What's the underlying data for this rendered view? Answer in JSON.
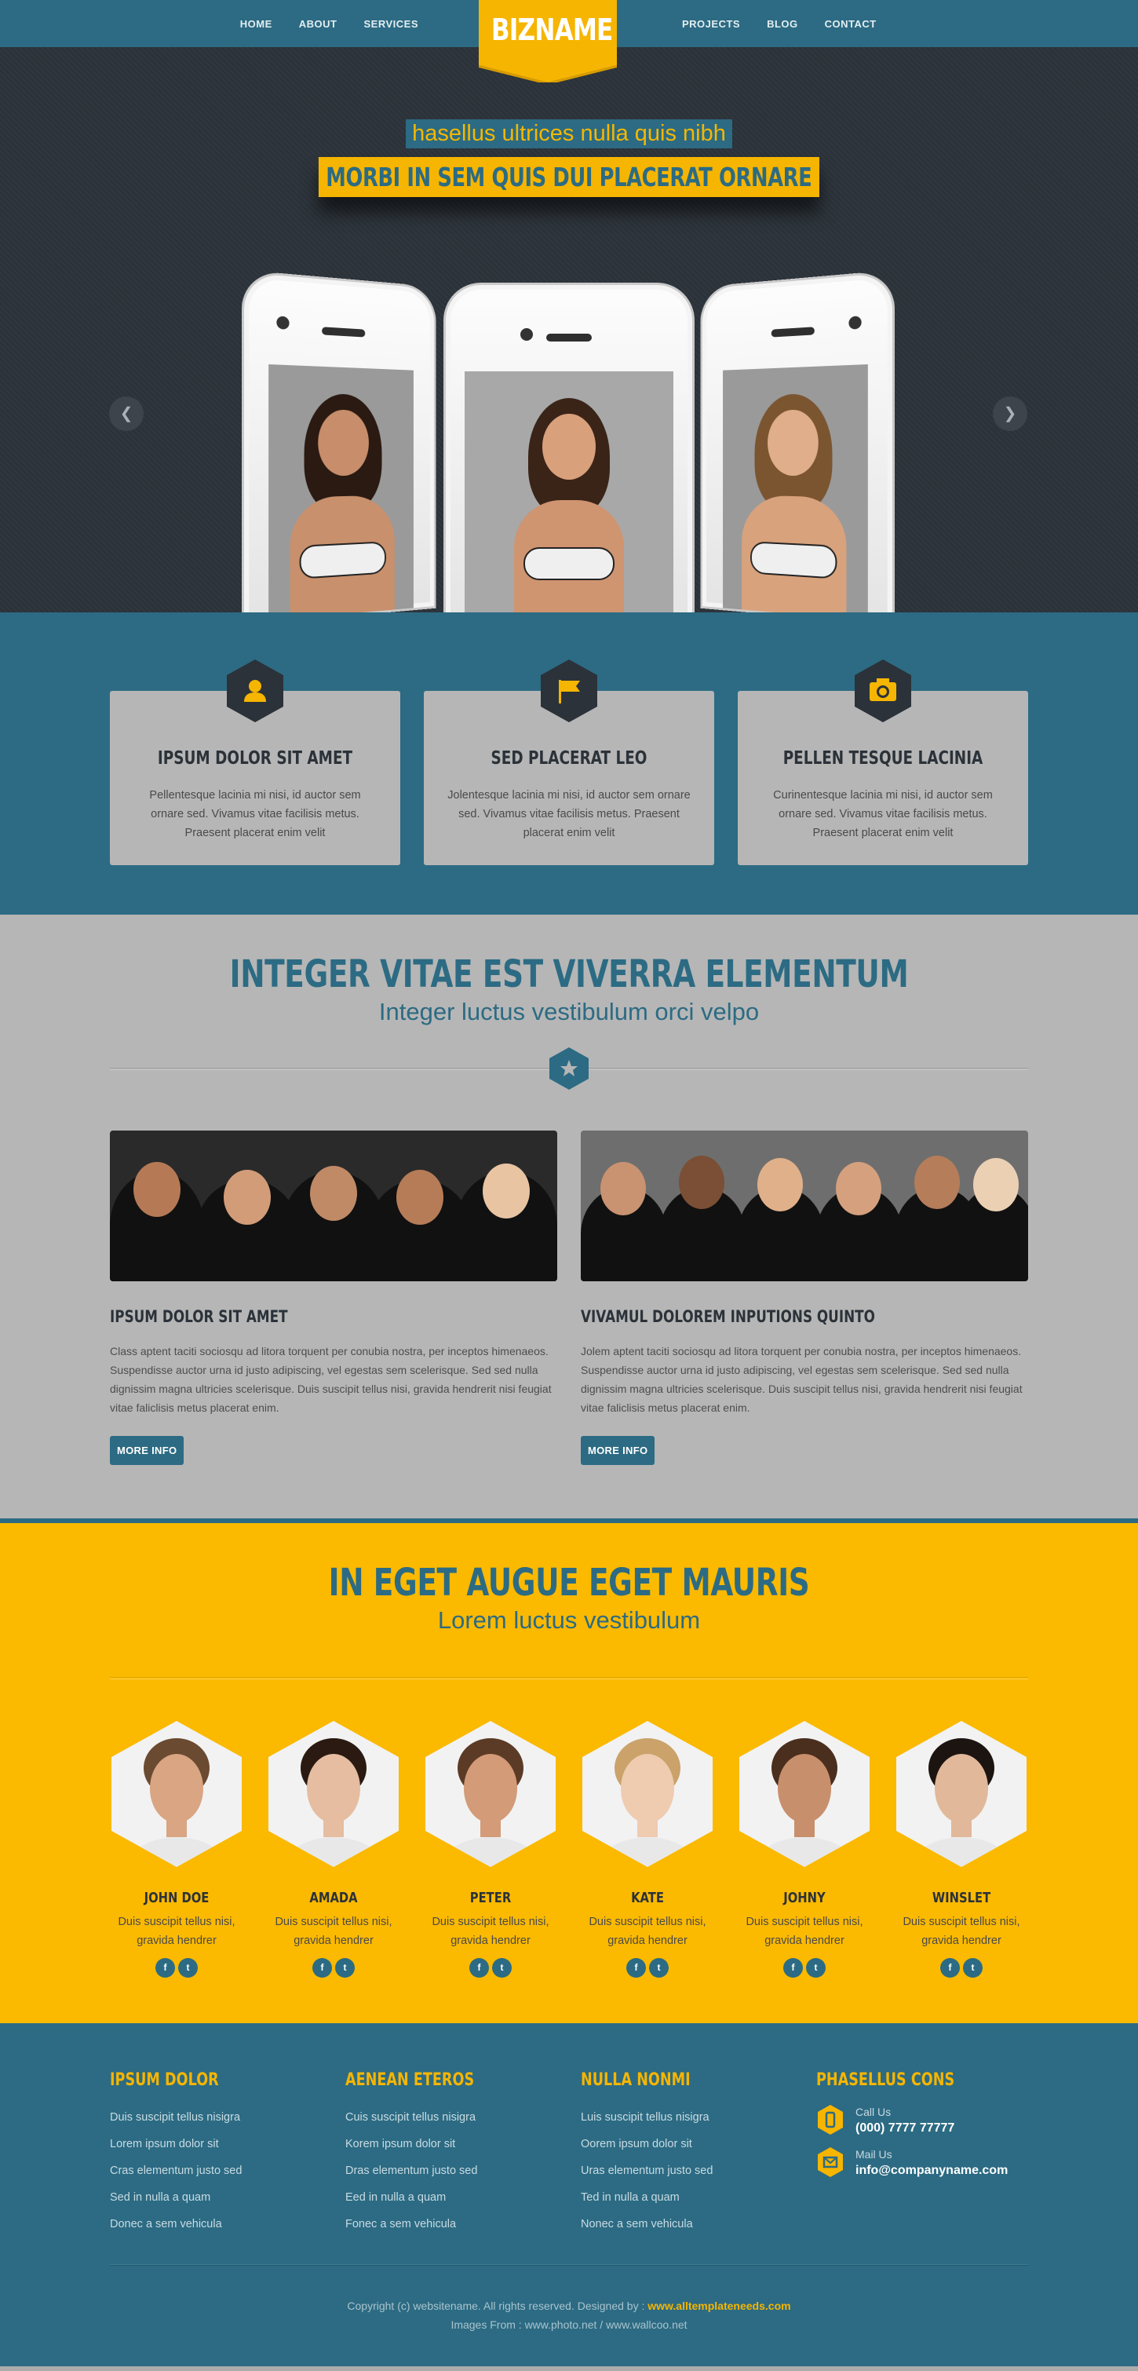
{
  "nav": {
    "left": [
      "HOME",
      "ABOUT",
      "SERVICES"
    ],
    "right": [
      "PROJECTS",
      "BLOG",
      "CONTACT"
    ],
    "logo": "BIZNAME"
  },
  "hero": {
    "subtitle": "hasellus ultrices nulla quis nibh",
    "title": "MORBI IN SEM QUIS DUI PLACERAT ORNARE"
  },
  "features": [
    {
      "icon": "user-icon",
      "title": "IPSUM DOLOR SIT AMET",
      "text": "Pellentesque lacinia mi nisi, id auctor sem ornare sed. Vivamus vitae facilisis metus. Praesent placerat enim velit"
    },
    {
      "icon": "flag-icon",
      "title": "SED PLACERAT LEO",
      "text": "Jolentesque lacinia mi nisi, id auctor sem ornare sed. Vivamus vitae facilisis metus. Praesent placerat enim velit"
    },
    {
      "icon": "camera-icon",
      "title": "PELLEN TESQUE LACINIA",
      "text": "Curinentesque lacinia mi nisi, id auctor sem ornare sed. Vivamus vitae facilisis metus. Praesent placerat enim velit"
    }
  ],
  "about": {
    "title": "INTEGER VITAE EST VIVERRA ELEMENTUM",
    "subtitle": "Integer luctus vestibulum orci velpo",
    "columns": [
      {
        "heading": "IPSUM DOLOR SIT AMET",
        "text": "Class aptent taciti sociosqu ad litora torquent per conubia nostra, per inceptos himenaeos. Suspendisse auctor urna id justo adipiscing, vel egestas sem scelerisque. Sed sed nulla dignissim magna ultricies scelerisque. Duis suscipit tellus nisi, gravida hendrerit nisi feugiat vitae faliclisis metus placerat enim.",
        "button": "MORE INFO"
      },
      {
        "heading": "VIVAMUL DOLOREM INPUTIONS QUINTO",
        "text": "Jolem aptent taciti sociosqu ad litora torquent per conubia nostra, per inceptos himenaeos. Suspendisse auctor urna id justo adipiscing, vel egestas sem scelerisque. Sed sed nulla dignissim magna ultricies scelerisque. Duis suscipit tellus nisi, gravida hendrerit nisi feugiat vitae faliclisis metus placerat enim.",
        "button": "MORE INFO"
      }
    ]
  },
  "team": {
    "title": "IN EGET AUGUE EGET MAURIS",
    "subtitle": "Lorem luctus vestibulum",
    "members": [
      {
        "name": "JOHN DOE",
        "text": "Duis suscipit tellus nisi, gravida hendrer"
      },
      {
        "name": "AMADA",
        "text": "Duis suscipit tellus nisi, gravida hendrer"
      },
      {
        "name": "PETER",
        "text": "Duis suscipit tellus nisi, gravida hendrer"
      },
      {
        "name": "KATE",
        "text": "Duis suscipit tellus nisi, gravida hendrer"
      },
      {
        "name": "JOHNY",
        "text": "Duis suscipit tellus nisi, gravida hendrer"
      },
      {
        "name": "WINSLET",
        "text": "Duis suscipit tellus nisi, gravida hendrer"
      }
    ],
    "social": [
      "f",
      "t"
    ]
  },
  "footer": {
    "columns": [
      {
        "heading": "IPSUM DOLOR",
        "links": [
          "Duis suscipit tellus nisigra",
          "Lorem ipsum dolor sit",
          "Cras elementum justo sed",
          "Sed in nulla a quam",
          "Donec a sem vehicula"
        ]
      },
      {
        "heading": "AENEAN ETEROS",
        "links": [
          "Cuis suscipit tellus nisigra",
          "Korem ipsum dolor sit",
          "Dras elementum justo sed",
          "Eed in nulla a quam",
          "Fonec a sem vehicula"
        ]
      },
      {
        "heading": "NULLA NONMI",
        "links": [
          "Luis suscipit tellus nisigra",
          "Oorem ipsum dolor sit",
          "Uras elementum justo sed",
          "Ted in nulla a quam",
          "Nonec a sem vehicula"
        ]
      }
    ],
    "contact": {
      "heading": "PHASELLUS CONS",
      "call_label": "Call Us",
      "call_value": "(000) 7777 77777",
      "mail_label": "Mail Us",
      "mail_value": "info@companyname.com"
    },
    "copyright_prefix": "Copyright (c) websitename. All rights reserved. Designed by :",
    "designer": "www.alltemplateneeds.com",
    "images_from": "Images From : www.photo.net / www.wallcoo.net"
  },
  "colors": {
    "teal": "#2c6b83",
    "yellow": "#f6b500",
    "dark": "#2b3239",
    "gray": "#b6b6b6"
  }
}
